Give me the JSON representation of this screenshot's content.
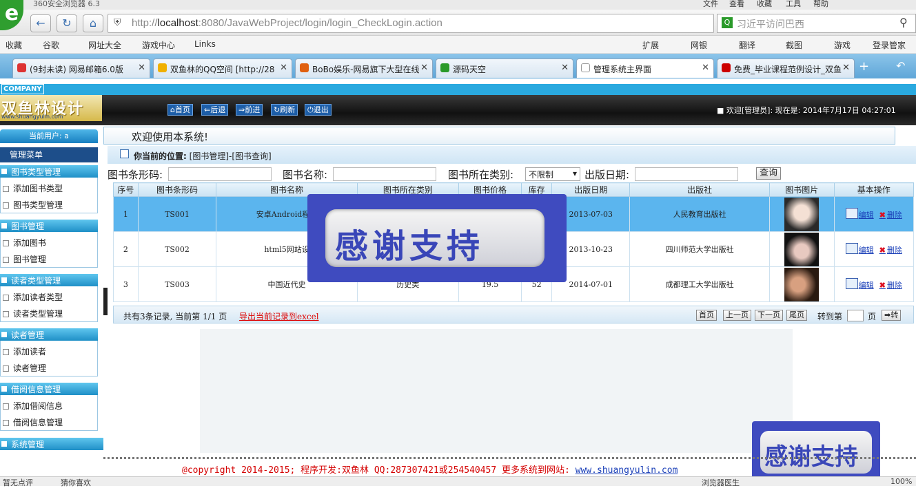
{
  "browser": {
    "title": "360安全浏览器 6.3",
    "menu": [
      "文件",
      "查看",
      "收藏",
      "工具",
      "帮助"
    ],
    "url_prefix": "http://",
    "url_host": "localhost",
    "url_rest": ":8080/JavaWebProject/login/login_CheckLogin.action",
    "search_text": "习近平访问巴西",
    "favorites": [
      "收藏",
      "谷歌",
      "网址大全",
      "游戏中心",
      "Links"
    ],
    "tools": [
      "扩展",
      "网银",
      "翻译",
      "截图",
      "游戏",
      "登录管家"
    ],
    "tabs": [
      {
        "label": "(9封未读) 网易邮箱6.0版",
        "color": "#d33"
      },
      {
        "label": "双鱼林的QQ空间 [http://28",
        "color": "#f0b000"
      },
      {
        "label": "BoBo娱乐-网易旗下大型在线",
        "color": "#e06010"
      },
      {
        "label": "源码天空",
        "color": "#2a9a2a"
      },
      {
        "label": "管理系统主界面",
        "color": "#999"
      },
      {
        "label": "免费_毕业课程范例设计_双鱼",
        "color": "#c00"
      }
    ],
    "status_left": [
      "暂无点评",
      "猜你喜欢"
    ],
    "status_right": [
      "浏览器医生",
      "100%"
    ]
  },
  "header": {
    "company": "COMPANY",
    "brand_name": "双鱼林设计",
    "brand_url": "www.shuangyulin.com",
    "buttons": [
      "首页",
      "后退",
      "前进",
      "刷新",
      "退出"
    ],
    "welcome": "■ 欢迎[管理员]:  现在是: 2014年7月17日 04:27:01"
  },
  "sidebar": {
    "current_user": "当前用户: a",
    "menu_title": "管理菜单",
    "groups": [
      {
        "title": "图书类型管理",
        "items": [
          "添加图书类型",
          "图书类型管理"
        ]
      },
      {
        "title": "图书管理",
        "items": [
          "添加图书",
          "图书管理"
        ]
      },
      {
        "title": "读者类型管理",
        "items": [
          "添加读者类型",
          "读者类型管理"
        ]
      },
      {
        "title": "读者管理",
        "items": [
          "添加读者",
          "读者管理"
        ]
      },
      {
        "title": "借阅信息管理",
        "items": [
          "添加借阅信息",
          "借阅信息管理"
        ]
      },
      {
        "title": "系统管理",
        "items": []
      }
    ]
  },
  "main": {
    "system_welcome": "欢迎使用本系统!",
    "position_label": "你当前的位置:",
    "position_path": "[图书管理]-[图书查询]",
    "filters": {
      "barcode_label": "图书条形码:",
      "name_label": "图书名称:",
      "category_label": "图书所在类别:",
      "category_value": "不限制",
      "date_label": "出版日期:",
      "query_button": "查询"
    },
    "table": {
      "columns": [
        "序号",
        "图书条形码",
        "图书名称",
        "图书所在类别",
        "图书价格",
        "库存",
        "出版日期",
        "出版社",
        "图书图片",
        "基本操作"
      ],
      "rows": [
        {
          "no": "1",
          "code": "TS001",
          "name": "安卓Android程序",
          "category": "",
          "price": "",
          "stock": "",
          "date": "2013-07-03",
          "publisher": "人民教育出版社"
        },
        {
          "no": "2",
          "code": "TS002",
          "name": "html5网站设",
          "category": "",
          "price": "",
          "stock": "",
          "date": "2013-10-23",
          "publisher": "四川师范大学出版社"
        },
        {
          "no": "3",
          "code": "TS003",
          "name": "中国近代史",
          "category": "历史类",
          "price": "19.5",
          "stock": "52",
          "date": "2014-07-01",
          "publisher": "成都理工大学出版社"
        }
      ],
      "edit_label": "编辑",
      "delete_label": "删除"
    },
    "pager": {
      "info": "共有3条记录, 当前第 1/1 页",
      "export": "导出当前记录到excel",
      "buttons": [
        "首页",
        "上一页",
        "下一页",
        "尾页"
      ],
      "goto_label": "转到第",
      "page_label": "页",
      "go_button": "➡转"
    },
    "overlay_text": "感谢支持",
    "footer_text": "@copyright 2014-2015; 程序开发:双鱼林  QQ:287307421或254540457  更多系统到网站:",
    "footer_link": "www.shuangyulin.com"
  }
}
